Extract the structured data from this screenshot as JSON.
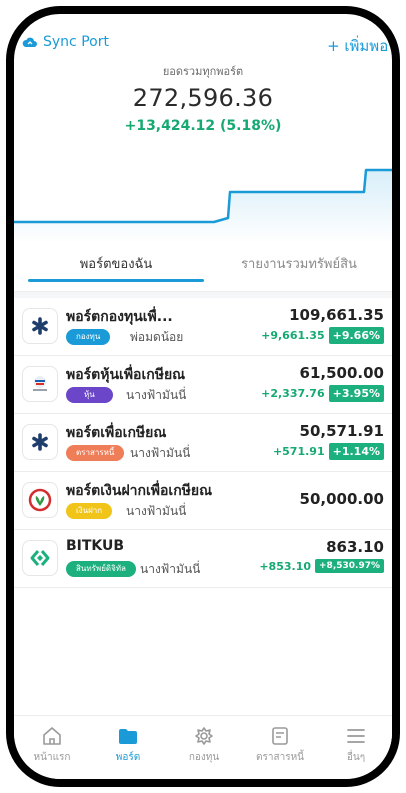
{
  "header": {
    "sync_label": "Sync Port",
    "add_label": "+ เพิ่มพอร์ต",
    "total_caption": "ยอดรวมทุกพอร์ต",
    "total_value": "272,596.36",
    "total_change": "+13,424.12 (5.18%)"
  },
  "colors": {
    "accent": "#1a9bd8",
    "positive": "#16a972"
  },
  "tabs": [
    {
      "label": "พอร์ตของฉัน",
      "active": true
    },
    {
      "label": "รายงานรวมทรัพย์สิน",
      "active": false
    }
  ],
  "portfolios": [
    {
      "name": "พอร์ตกองทุนเพื่...",
      "badge": "กองทุน",
      "badge_color": "#1a9bd8",
      "owner": "พ่อมดน้อย",
      "value": "109,661.35",
      "change": "+9,661.35",
      "percent": "+9.66%",
      "icon": "asterisk-logo-icon"
    },
    {
      "name": "พอร์ตหุ้นเพื่อเกษียณ",
      "badge": "หุ้น",
      "badge_color": "#6b46c9",
      "owner": "นางฟ้ามันนี่",
      "value": "61,500.00",
      "change": "+2,337.76",
      "percent": "+3.95%",
      "icon": "broker-logo-icon"
    },
    {
      "name": "พอร์ตเพื่อเกษียณ",
      "badge": "ตราสารหนี้",
      "badge_color": "#ef7d57",
      "owner": "นางฟ้ามันนี่",
      "value": "50,571.91",
      "change": "+571.91",
      "percent": "+1.14%",
      "icon": "asterisk-logo-icon"
    },
    {
      "name": "พอร์ตเงินฝากเพื่อเกษียณ",
      "badge": "เงินฝาก",
      "badge_color": "#f0c419",
      "owner": "นางฟ้ามันนี่",
      "value": "50,000.00",
      "change": "",
      "percent": "",
      "icon": "bank-logo-icon"
    },
    {
      "name": "BITKUB",
      "badge": "สินทรัพย์ดิจิทัล",
      "badge_color": "#1bb07d",
      "owner": "นางฟ้ามันนี่",
      "value": "863.10",
      "change": "+853.10",
      "percent": "+8,530.97%",
      "icon": "bitkub-logo-icon"
    }
  ],
  "nav": [
    {
      "label": "หน้าแรก",
      "icon": "home-icon",
      "active": false
    },
    {
      "label": "พอร์ต",
      "icon": "folder-icon",
      "active": true
    },
    {
      "label": "กองทุน",
      "icon": "fund-icon",
      "active": false
    },
    {
      "label": "ตราสารหนี้",
      "icon": "document-icon",
      "active": false
    },
    {
      "label": "อื่นๆ",
      "icon": "menu-icon",
      "active": false
    }
  ]
}
